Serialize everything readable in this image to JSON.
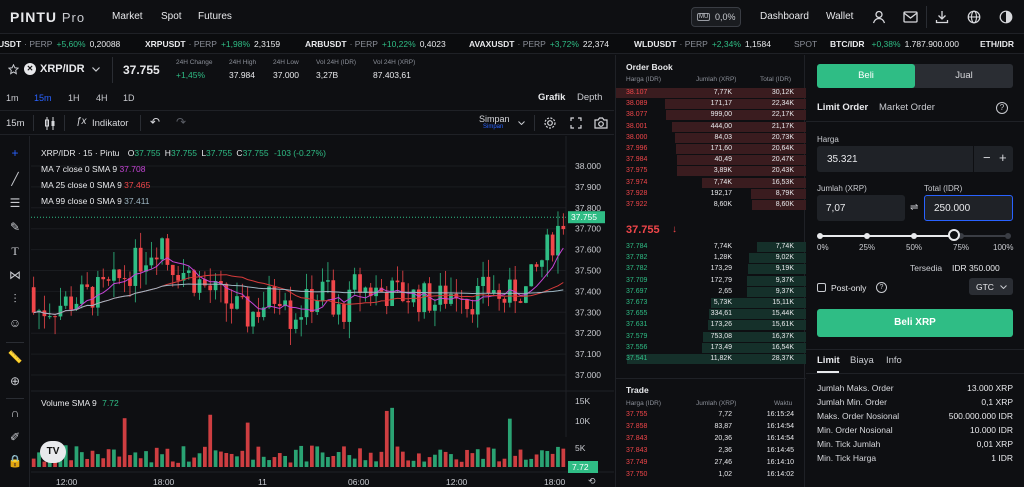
{
  "nav": {
    "logo": "PINTU",
    "logo_sub": "Pro",
    "market": "Market",
    "spot": "Spot",
    "futures": "Futures",
    "mu_badge": "MU",
    "mu_value": "0,0%",
    "dashboard": "Dashboard",
    "wallet": "Wallet"
  },
  "ticker": [
    {
      "sym": "USDT",
      "type": "· PERP",
      "chg": "+5,60%",
      "price": "0,20088"
    },
    {
      "sym": "XRPUSDT",
      "type": "· PERP",
      "chg": "+1,98%",
      "price": "2,3159"
    },
    {
      "sym": "ARBUSDT",
      "type": "· PERP",
      "chg": "+10,22%",
      "price": "0,4023"
    },
    {
      "sym": "AVAXUSDT",
      "type": "· PERP",
      "chg": "+3,72%",
      "price": "22,374"
    },
    {
      "sym": "WLDUSDT",
      "type": "· PERP",
      "chg": "+2,34%",
      "price": "1,1584"
    },
    {
      "sym": "SPOT",
      "type": "",
      "chg": "",
      "price": ""
    },
    {
      "sym": "BTC/IDR",
      "type": "",
      "chg": "+0,38%",
      "price": "1.787.900.000"
    },
    {
      "sym": "ETH/IDR",
      "type": "",
      "chg": "",
      "price": ""
    }
  ],
  "pair": {
    "name": "XRP/IDR",
    "price": "37.755",
    "change_label": "24H Change",
    "change": "+1,45%",
    "high_label": "24H High",
    "high": "37.984",
    "low_label": "24H Low",
    "low": "37.000",
    "volidr_label": "Vol 24H (IDR)",
    "volidr": "3,27B",
    "volxrp_label": "Vol 24H (XRP)",
    "volxrp": "87.403,61"
  },
  "timeframes": [
    "1m",
    "15m",
    "1H",
    "4H",
    "1D"
  ],
  "views": {
    "chart": "Grafik",
    "depth": "Depth"
  },
  "toolbar": {
    "interval": "15m",
    "indicator": "Indikator",
    "save": "Simpan",
    "save_sub": "Simpan"
  },
  "chart_legend": {
    "title": "XRP/IDR · 15 · Pintu",
    "o_label": "O",
    "o": "37.755",
    "h_label": "H",
    "h": "37.755",
    "l_label": "L",
    "l": "37.755",
    "c_label": "C",
    "c": "37.755",
    "chg": "-103 (-0.27%)",
    "ma7": "MA 7 close 0 SMA 9",
    "ma7v": "37.708",
    "ma25": "MA 25 close 0 SMA 9",
    "ma25v": "37.465",
    "ma99": "MA 99 close 0 SMA 9",
    "ma99v": "37.411",
    "vol": "Volume SMA 9",
    "volv": "7.72"
  },
  "chart_data": {
    "type": "candlestick",
    "y_ticks": [
      "38.000",
      "37.900",
      "37.800",
      "37.700",
      "37.600",
      "37.500",
      "37.400",
      "37.300",
      "37.200",
      "37.100",
      "37.000"
    ],
    "last_price": "37.755",
    "vol_ticks": [
      "15K",
      "10K",
      "5K"
    ],
    "vol_last": "7.72",
    "x_ticks": [
      "12:00",
      "18:00",
      "11",
      "06:00",
      "12:00",
      "18:00"
    ],
    "colors": {
      "up": "#2fbd85",
      "down": "#f0464a",
      "ma7": "#c545d6",
      "ma25": "#d83b3b",
      "ma99": "#9fb7c4"
    }
  },
  "orderbook": {
    "title": "Order Book",
    "h_price": "Harga (IDR)",
    "h_qty": "Jumlah (XRP)",
    "h_total": "Total (IDR)",
    "asks": [
      [
        "38.107",
        "7,77K",
        "30,12K"
      ],
      [
        "38.089",
        "171,17",
        "22,34K"
      ],
      [
        "38.077",
        "999,00",
        "22,17K"
      ],
      [
        "38.001",
        "444,00",
        "21,17K"
      ],
      [
        "38.000",
        "84,03",
        "20,73K"
      ],
      [
        "37.996",
        "171,60",
        "20,64K"
      ],
      [
        "37.984",
        "40,49",
        "20,47K"
      ],
      [
        "37.975",
        "3,89K",
        "20,43K"
      ],
      [
        "37.974",
        "7,74K",
        "16,53K"
      ],
      [
        "37.928",
        "192,17",
        "8,79K"
      ],
      [
        "37.922",
        "8,60K",
        "8,60K"
      ]
    ],
    "mid": "37.755",
    "bids": [
      [
        "37.784",
        "7,74K",
        "7,74K"
      ],
      [
        "37.782",
        "1,28K",
        "9,02K"
      ],
      [
        "37.782",
        "173,29",
        "9,19K"
      ],
      [
        "37.709",
        "172,79",
        "9,37K"
      ],
      [
        "37.697",
        "2,65",
        "9,37K"
      ],
      [
        "37.673",
        "5,73K",
        "15,11K"
      ],
      [
        "37.655",
        "334,61",
        "15,44K"
      ],
      [
        "37.631",
        "173,26",
        "15,61K"
      ],
      [
        "37.579",
        "753,08",
        "16,37K"
      ],
      [
        "37.556",
        "173,49",
        "16,54K"
      ],
      [
        "37.541",
        "11,82K",
        "28,37K"
      ]
    ]
  },
  "trades": {
    "title": "Trade",
    "h_price": "Harga (IDR)",
    "h_qty": "Jumlah (XRP)",
    "h_time": "Waktu",
    "rows": [
      [
        "37.755",
        "7,72",
        "16:15:24"
      ],
      [
        "37.858",
        "83,87",
        "16:14:54"
      ],
      [
        "37.843",
        "20,36",
        "16:14:54"
      ],
      [
        "37.843",
        "2,36",
        "16:14:45"
      ],
      [
        "37.749",
        "27,46",
        "16:14:10"
      ],
      [
        "37.750",
        "1,02",
        "16:14:02"
      ]
    ]
  },
  "trade_panel": {
    "buy": "Beli",
    "sell": "Jual",
    "limit_order": "Limit Order",
    "market_order": "Market Order",
    "price_label": "Harga",
    "price_value": "35.321",
    "qty_label": "Jumlah (XRP)",
    "qty_value": "7,07",
    "total_label": "Total (IDR)",
    "total_value": "250.000",
    "slider": [
      "0%",
      "25%",
      "50%",
      "75%",
      "100%"
    ],
    "slider_value": "75%",
    "available_label": "Tersedia",
    "available_value": "IDR 350.000",
    "post_only": "Post-only",
    "gtc": "GTC",
    "buy_button": "Beli XRP",
    "accent": "#2fbd85"
  },
  "limits": {
    "tabs": [
      "Limit",
      "Biaya",
      "Info"
    ],
    "rows": [
      [
        "Jumlah Maks. Order",
        "13.000 XRP"
      ],
      [
        "Jumlah Min. Order",
        "0,1 XRP"
      ],
      [
        "Maks. Order Nosional",
        "500.000.000 IDR"
      ],
      [
        "Min. Order Nosional",
        "10.000 IDR"
      ],
      [
        "Min. Tick Jumlah",
        "0,01 XRP"
      ],
      [
        "Min. Tick Harga",
        "1 IDR"
      ]
    ]
  }
}
